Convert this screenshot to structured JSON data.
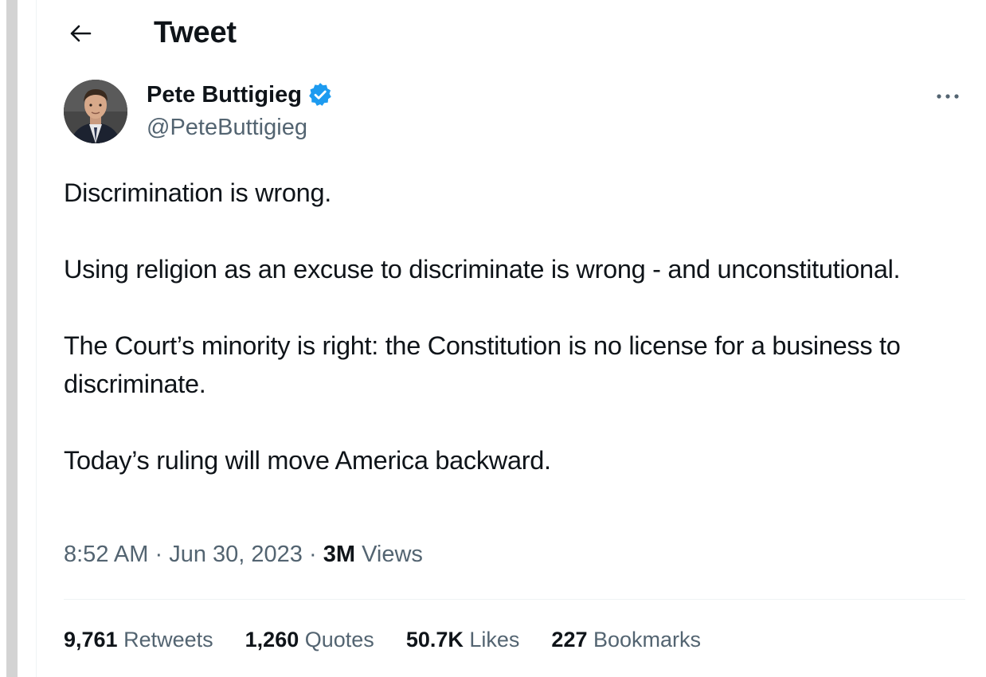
{
  "header": {
    "title": "Tweet",
    "back_icon": "arrow-left-icon"
  },
  "author": {
    "display_name": "Pete Buttigieg",
    "handle": "@PeteButtigieg",
    "verified_icon": "verified-badge-icon",
    "verified_color": "#1d9bf0"
  },
  "tweet": {
    "paragraphs": [
      "Discrimination is wrong.",
      "Using religion as an excuse to discriminate is wrong - and unconstitutional.",
      "The Court’s minority is right: the Constitution is no license for a business to discriminate.",
      "Today’s ruling will move America backward."
    ],
    "time": "8:52 AM",
    "separator": "·",
    "date": "Jun 30, 2023",
    "views_count": "3M",
    "views_label": "Views"
  },
  "stats": {
    "retweets_count": "9,761",
    "retweets_label": "Retweets",
    "quotes_count": "1,260",
    "quotes_label": "Quotes",
    "likes_count": "50.7K",
    "likes_label": "Likes",
    "bookmarks_count": "227",
    "bookmarks_label": "Bookmarks"
  },
  "colors": {
    "text": "#0f1419",
    "secondary": "#536471",
    "border": "#eff3f4"
  }
}
